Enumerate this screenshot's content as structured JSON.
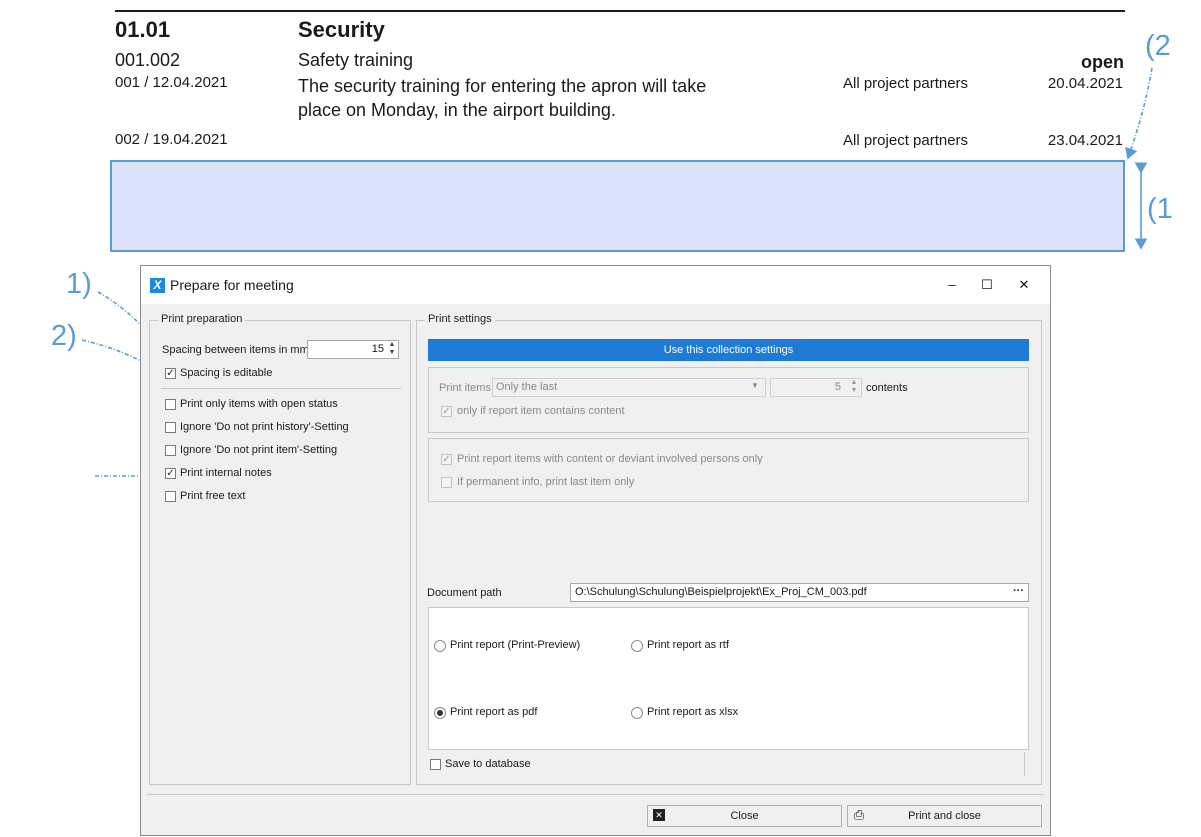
{
  "report": {
    "section_number": "01.01",
    "section_title": "Security",
    "item_number": "001.002",
    "item_title": "Safety training",
    "item_status": "open",
    "entries": [
      {
        "id_date": "001 / 12.04.2021",
        "text_line1": "The security training for entering the apron will take",
        "text_line2": "place on Monday, in the airport building.",
        "responsible": "All project partners",
        "due": "20.04.2021"
      },
      {
        "id_date": "002 / 19.04.2021",
        "responsible": "All project partners",
        "due": "23.04.2021"
      }
    ]
  },
  "annotations": {
    "label_1_left": "1)",
    "label_2_left": "2)",
    "label_1_right": "(1",
    "label_2_right": "(2",
    "color": "#5b9bd5"
  },
  "dialog": {
    "title": "Prepare for meeting",
    "app_icon": "X",
    "minimize": "‒",
    "maximize": "☐",
    "close": "✕",
    "print_preparation": {
      "title": "Print preparation",
      "spacing_label": "Spacing between items in mm",
      "spacing_value": "15",
      "spacing_editable_label": "Spacing is editable",
      "spacing_editable_checked": true,
      "options": [
        {
          "label": "Print only items with open status",
          "checked": false
        },
        {
          "label": "Ignore 'Do not print history'-Setting",
          "checked": false
        },
        {
          "label": "Ignore 'Do not print item'-Setting",
          "checked": false
        },
        {
          "label": "Print internal notes",
          "checked": true
        },
        {
          "label": "Print free text",
          "checked": false
        }
      ]
    },
    "print_settings": {
      "title": "Print settings",
      "use_collection_button": "Use this collection settings",
      "print_items_label": "Print items",
      "print_items_value": "Only the last",
      "count_value": "5",
      "contents_label": "contents",
      "only_if_content_label": "only if report item contains content",
      "with_content_label": "Print report items with content or deviant involved persons only",
      "permanent_info_label": "If permanent info, print last item only",
      "document_path_label": "Document path",
      "document_path_value": "O:\\Schulung\\Schulung\\Beispielprojekt\\Ex_Proj_CM_003.pdf",
      "browse_label": "···",
      "outputs": [
        {
          "label": "Print report (Print-Preview)",
          "selected": false
        },
        {
          "label": "Print report as rtf",
          "selected": false
        },
        {
          "label": "Print report as pdf",
          "selected": true
        },
        {
          "label": "Print report as xlsx",
          "selected": false
        }
      ],
      "save_to_db_label": "Save to database"
    },
    "buttons": {
      "close": "Close",
      "print_and_close": "Print and close"
    }
  }
}
